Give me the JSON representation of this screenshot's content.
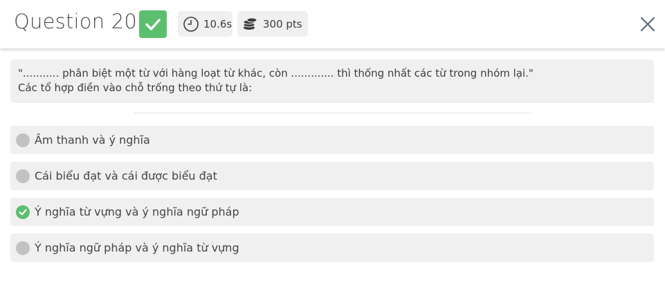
{
  "header": {
    "title": "Question 20",
    "status": "correct",
    "time_label": "10.6s",
    "points_label": "300 pts",
    "status_icon": "check-icon",
    "time_icon": "clock-icon",
    "points_icon": "coins-icon",
    "close_icon": "close-icon"
  },
  "question": {
    "line1": "\"........... phân biệt một từ với hàng loạt từ khác, còn ............. thì thống nhất các từ trong nhóm lại.\"",
    "line2": "Các tổ hợp điền vào chỗ trống theo thứ tự là:"
  },
  "options": [
    {
      "label": "Âm thanh và ý nghĩa",
      "correct": false
    },
    {
      "label": "Cái biểu đạt và cái được biểu đạt",
      "correct": false
    },
    {
      "label": "Ý nghĩa từ vựng và ý nghĩa ngữ pháp",
      "correct": true
    },
    {
      "label": "Ý nghĩa ngữ pháp và ý nghĩa từ vựng",
      "correct": false
    }
  ],
  "colors": {
    "correct_green": "#5cbf6e",
    "neutral_marker": "#c2c2c2",
    "panel_bg": "#f0f0f0",
    "close_icon": "#6a7684"
  }
}
